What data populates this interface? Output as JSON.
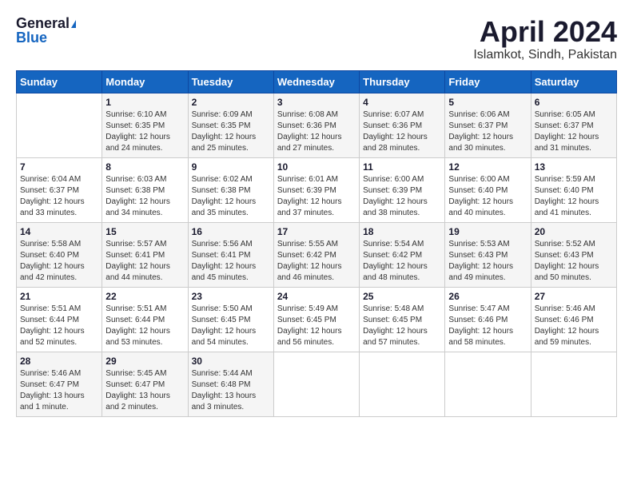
{
  "header": {
    "logo_general": "General",
    "logo_blue": "Blue",
    "title": "April 2024",
    "location": "Islamkot, Sindh, Pakistan"
  },
  "calendar": {
    "days_of_week": [
      "Sunday",
      "Monday",
      "Tuesday",
      "Wednesday",
      "Thursday",
      "Friday",
      "Saturday"
    ],
    "weeks": [
      [
        {
          "day": "",
          "sunrise": "",
          "sunset": "",
          "daylight": ""
        },
        {
          "day": "1",
          "sunrise": "Sunrise: 6:10 AM",
          "sunset": "Sunset: 6:35 PM",
          "daylight": "Daylight: 12 hours and 24 minutes."
        },
        {
          "day": "2",
          "sunrise": "Sunrise: 6:09 AM",
          "sunset": "Sunset: 6:35 PM",
          "daylight": "Daylight: 12 hours and 25 minutes."
        },
        {
          "day": "3",
          "sunrise": "Sunrise: 6:08 AM",
          "sunset": "Sunset: 6:36 PM",
          "daylight": "Daylight: 12 hours and 27 minutes."
        },
        {
          "day": "4",
          "sunrise": "Sunrise: 6:07 AM",
          "sunset": "Sunset: 6:36 PM",
          "daylight": "Daylight: 12 hours and 28 minutes."
        },
        {
          "day": "5",
          "sunrise": "Sunrise: 6:06 AM",
          "sunset": "Sunset: 6:37 PM",
          "daylight": "Daylight: 12 hours and 30 minutes."
        },
        {
          "day": "6",
          "sunrise": "Sunrise: 6:05 AM",
          "sunset": "Sunset: 6:37 PM",
          "daylight": "Daylight: 12 hours and 31 minutes."
        }
      ],
      [
        {
          "day": "7",
          "sunrise": "Sunrise: 6:04 AM",
          "sunset": "Sunset: 6:37 PM",
          "daylight": "Daylight: 12 hours and 33 minutes."
        },
        {
          "day": "8",
          "sunrise": "Sunrise: 6:03 AM",
          "sunset": "Sunset: 6:38 PM",
          "daylight": "Daylight: 12 hours and 34 minutes."
        },
        {
          "day": "9",
          "sunrise": "Sunrise: 6:02 AM",
          "sunset": "Sunset: 6:38 PM",
          "daylight": "Daylight: 12 hours and 35 minutes."
        },
        {
          "day": "10",
          "sunrise": "Sunrise: 6:01 AM",
          "sunset": "Sunset: 6:39 PM",
          "daylight": "Daylight: 12 hours and 37 minutes."
        },
        {
          "day": "11",
          "sunrise": "Sunrise: 6:00 AM",
          "sunset": "Sunset: 6:39 PM",
          "daylight": "Daylight: 12 hours and 38 minutes."
        },
        {
          "day": "12",
          "sunrise": "Sunrise: 6:00 AM",
          "sunset": "Sunset: 6:40 PM",
          "daylight": "Daylight: 12 hours and 40 minutes."
        },
        {
          "day": "13",
          "sunrise": "Sunrise: 5:59 AM",
          "sunset": "Sunset: 6:40 PM",
          "daylight": "Daylight: 12 hours and 41 minutes."
        }
      ],
      [
        {
          "day": "14",
          "sunrise": "Sunrise: 5:58 AM",
          "sunset": "Sunset: 6:40 PM",
          "daylight": "Daylight: 12 hours and 42 minutes."
        },
        {
          "day": "15",
          "sunrise": "Sunrise: 5:57 AM",
          "sunset": "Sunset: 6:41 PM",
          "daylight": "Daylight: 12 hours and 44 minutes."
        },
        {
          "day": "16",
          "sunrise": "Sunrise: 5:56 AM",
          "sunset": "Sunset: 6:41 PM",
          "daylight": "Daylight: 12 hours and 45 minutes."
        },
        {
          "day": "17",
          "sunrise": "Sunrise: 5:55 AM",
          "sunset": "Sunset: 6:42 PM",
          "daylight": "Daylight: 12 hours and 46 minutes."
        },
        {
          "day": "18",
          "sunrise": "Sunrise: 5:54 AM",
          "sunset": "Sunset: 6:42 PM",
          "daylight": "Daylight: 12 hours and 48 minutes."
        },
        {
          "day": "19",
          "sunrise": "Sunrise: 5:53 AM",
          "sunset": "Sunset: 6:43 PM",
          "daylight": "Daylight: 12 hours and 49 minutes."
        },
        {
          "day": "20",
          "sunrise": "Sunrise: 5:52 AM",
          "sunset": "Sunset: 6:43 PM",
          "daylight": "Daylight: 12 hours and 50 minutes."
        }
      ],
      [
        {
          "day": "21",
          "sunrise": "Sunrise: 5:51 AM",
          "sunset": "Sunset: 6:44 PM",
          "daylight": "Daylight: 12 hours and 52 minutes."
        },
        {
          "day": "22",
          "sunrise": "Sunrise: 5:51 AM",
          "sunset": "Sunset: 6:44 PM",
          "daylight": "Daylight: 12 hours and 53 minutes."
        },
        {
          "day": "23",
          "sunrise": "Sunrise: 5:50 AM",
          "sunset": "Sunset: 6:45 PM",
          "daylight": "Daylight: 12 hours and 54 minutes."
        },
        {
          "day": "24",
          "sunrise": "Sunrise: 5:49 AM",
          "sunset": "Sunset: 6:45 PM",
          "daylight": "Daylight: 12 hours and 56 minutes."
        },
        {
          "day": "25",
          "sunrise": "Sunrise: 5:48 AM",
          "sunset": "Sunset: 6:45 PM",
          "daylight": "Daylight: 12 hours and 57 minutes."
        },
        {
          "day": "26",
          "sunrise": "Sunrise: 5:47 AM",
          "sunset": "Sunset: 6:46 PM",
          "daylight": "Daylight: 12 hours and 58 minutes."
        },
        {
          "day": "27",
          "sunrise": "Sunrise: 5:46 AM",
          "sunset": "Sunset: 6:46 PM",
          "daylight": "Daylight: 12 hours and 59 minutes."
        }
      ],
      [
        {
          "day": "28",
          "sunrise": "Sunrise: 5:46 AM",
          "sunset": "Sunset: 6:47 PM",
          "daylight": "Daylight: 13 hours and 1 minute."
        },
        {
          "day": "29",
          "sunrise": "Sunrise: 5:45 AM",
          "sunset": "Sunset: 6:47 PM",
          "daylight": "Daylight: 13 hours and 2 minutes."
        },
        {
          "day": "30",
          "sunrise": "Sunrise: 5:44 AM",
          "sunset": "Sunset: 6:48 PM",
          "daylight": "Daylight: 13 hours and 3 minutes."
        },
        {
          "day": "",
          "sunrise": "",
          "sunset": "",
          "daylight": ""
        },
        {
          "day": "",
          "sunrise": "",
          "sunset": "",
          "daylight": ""
        },
        {
          "day": "",
          "sunrise": "",
          "sunset": "",
          "daylight": ""
        },
        {
          "day": "",
          "sunrise": "",
          "sunset": "",
          "daylight": ""
        }
      ]
    ]
  }
}
